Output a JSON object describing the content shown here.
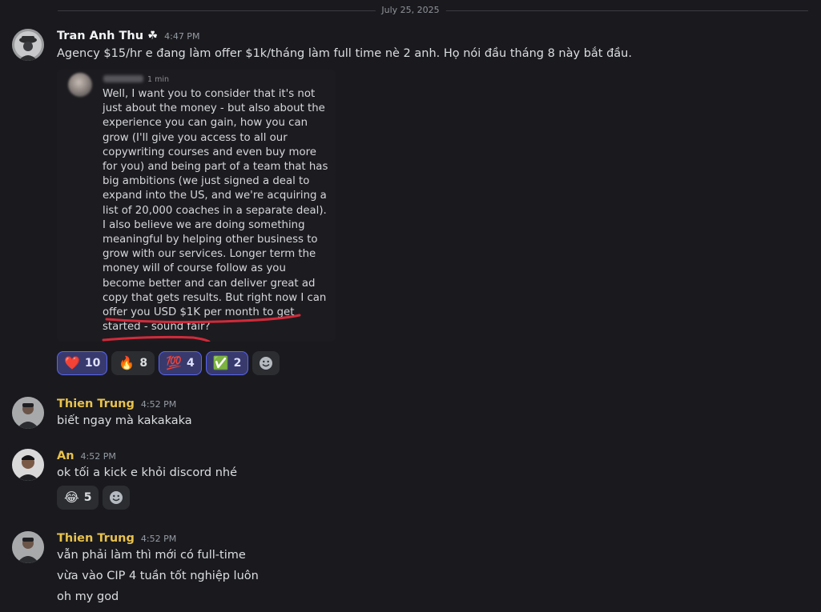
{
  "date_divider": "July 25, 2025",
  "messages": [
    {
      "author": "Tran Anh Thu ☘",
      "time": "4:47 PM",
      "lines": [
        "Agency $15/hr e đang làm offer $1k/tháng làm full time nè 2 anh. Họ nói đầu tháng 8 này bắt đầu."
      ],
      "attachment": {
        "time": "1 min",
        "text": "Well, I want you to consider that it's not just about the money - but also about the experience you can gain, how you can grow (I'll give you access to all our copywriting courses and even buy more for you) and being part of a team that has big ambitions (we just signed a deal to expand into the US, and we're acquiring a list of 20,000 coaches in a separate deal). I also believe we are doing something meaningful by helping other business to grow with our services.  Longer term the money will of course follow as you become better and can deliver great ad copy that gets results. But right now I can offer you USD $1K per month to get started - sound fair?"
      },
      "reactions": [
        {
          "emoji": "❤️",
          "count": "10"
        },
        {
          "emoji": "🔥",
          "count": "8"
        },
        {
          "emoji": "💯",
          "count": "4"
        },
        {
          "emoji": "✅",
          "count": "2"
        }
      ]
    },
    {
      "author": "Thien Trung",
      "time": "4:52 PM",
      "lines": [
        "biết ngay mà kakakaka"
      ]
    },
    {
      "author": "An",
      "time": "4:52 PM",
      "lines": [
        "ok tối a kick e khỏi discord nhé"
      ],
      "reactions": [
        {
          "emoji": "😂",
          "count": "5"
        }
      ]
    },
    {
      "author": "Thien Trung",
      "time": "4:52 PM",
      "lines": [
        "vẫn phải làm thì mới có full-time",
        "vừa vào CIP 4 tuần tốt nghiệp luôn",
        "oh my god"
      ]
    }
  ],
  "colors": {
    "background": "#1a1a1e",
    "author_gold": "#e8c24c",
    "reaction_active_bg": "#383a6e",
    "reaction_active_border": "#5865f2",
    "underline_red": "#d22a3a"
  }
}
